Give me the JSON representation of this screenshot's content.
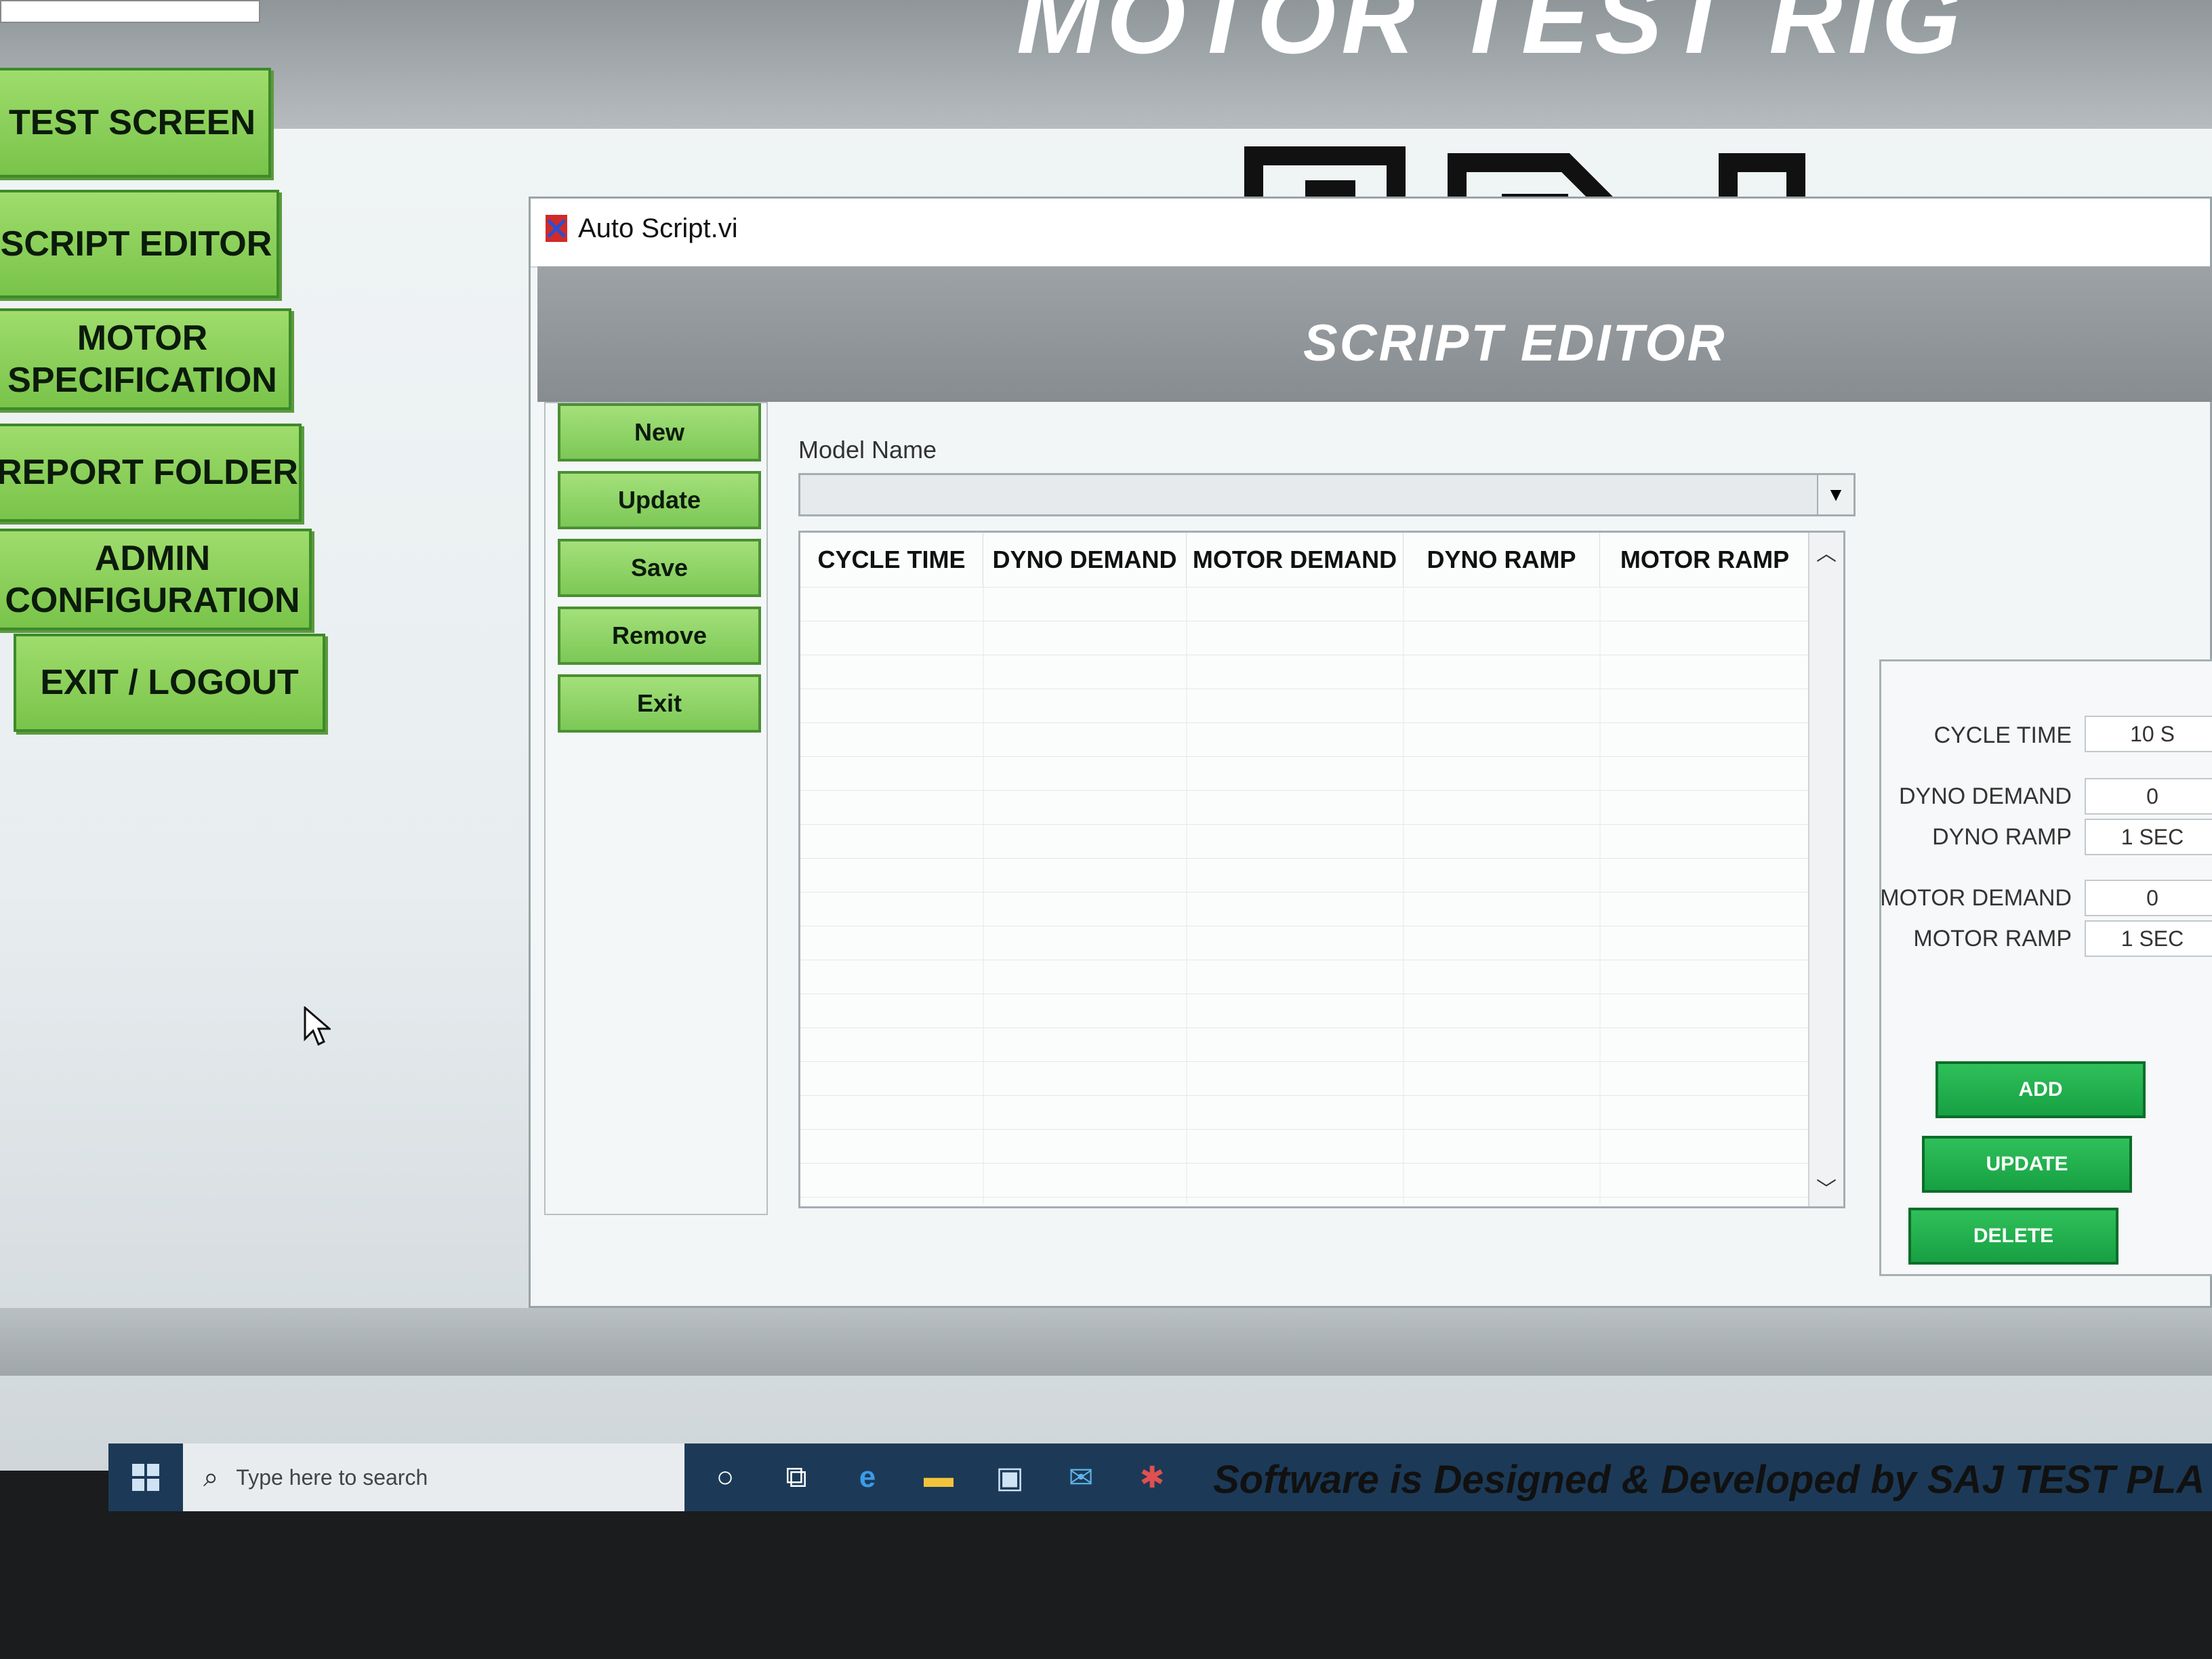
{
  "app": {
    "title": "MOTOR TEST RIG",
    "footer": "Software is Designed & Developed by SAJ TEST PLA"
  },
  "sidebar": {
    "items": [
      {
        "label": "TEST SCREEN"
      },
      {
        "label": "SCRIPT EDITOR"
      },
      {
        "label": "MOTOR SPECIFICATION"
      },
      {
        "label": "REPORT FOLDER"
      },
      {
        "label": "ADMIN CONFIGURATION"
      },
      {
        "label": "EXIT / LOGOUT"
      }
    ]
  },
  "window": {
    "title": "Auto Script.vi",
    "header": "SCRIPT EDITOR"
  },
  "commands": {
    "new": "New",
    "update": "Update",
    "save": "Save",
    "remove": "Remove",
    "exit": "Exit"
  },
  "model": {
    "label": "Model Name",
    "value": ""
  },
  "table": {
    "columns": [
      "CYCLE TIME",
      "DYNO DEMAND",
      "MOTOR DEMAND",
      "DYNO RAMP",
      "MOTOR RAMP"
    ],
    "rows": []
  },
  "entry": {
    "cycle_time_label": "CYCLE TIME",
    "cycle_time_value": "10 S",
    "dyno_demand_label": "DYNO DEMAND",
    "dyno_demand_value": "0",
    "dyno_ramp_label": "DYNO RAMP",
    "dyno_ramp_value": "1  SEC",
    "motor_demand_label": "MOTOR DEMAND",
    "motor_demand_value": "0",
    "motor_ramp_label": "MOTOR RAMP",
    "motor_ramp_value": "1  SEC",
    "add": "ADD",
    "update": "UPDATE",
    "delete": "DELETE"
  },
  "taskbar": {
    "search_placeholder": "Type here to search",
    "icons": [
      "windows-start-icon",
      "cortana-icon",
      "task-view-icon",
      "edge-icon",
      "file-explorer-icon",
      "store-icon",
      "mail-icon",
      "labview-icon"
    ]
  },
  "colors": {
    "sidebar_green": "#8fd35e",
    "action_green": "#1fa84a",
    "header_gray": "#8f9699",
    "taskbar": "#1c3a57"
  }
}
